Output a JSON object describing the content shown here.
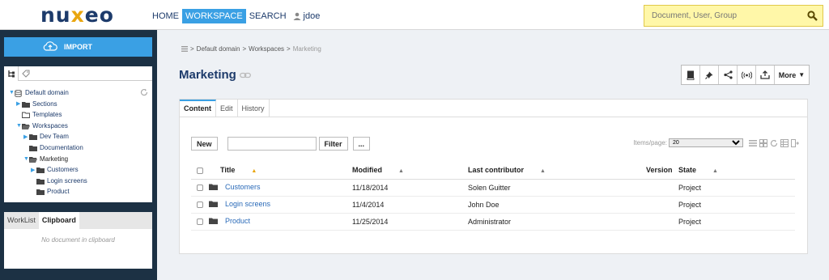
{
  "header": {
    "logo_text_1": "nu",
    "logo_text_2": "x",
    "logo_text_3": "eo",
    "nav": [
      "HOME",
      "WORKSPACE",
      "SEARCH"
    ],
    "active_nav": "WORKSPACE",
    "user": "jdoe",
    "search_placeholder": "Document, User, Group"
  },
  "sidebar": {
    "import_label": "IMPORT",
    "tree": [
      {
        "label": "Default domain",
        "level": 0,
        "expanded": true
      },
      {
        "label": "Sections",
        "level": 1,
        "expanded": false
      },
      {
        "label": "Templates",
        "level": 1,
        "expanded": null
      },
      {
        "label": "Workspaces",
        "level": 1,
        "expanded": true
      },
      {
        "label": "Dev Team",
        "level": 2,
        "expanded": false
      },
      {
        "label": "Documentation",
        "level": 2,
        "expanded": null
      },
      {
        "label": "Marketing",
        "level": 2,
        "expanded": true,
        "selected": true
      },
      {
        "label": "Customers",
        "level": 3,
        "expanded": false
      },
      {
        "label": "Login screens",
        "level": 3,
        "expanded": null
      },
      {
        "label": "Product",
        "level": 3,
        "expanded": null
      }
    ],
    "clip_tabs": [
      "WorkList",
      "Clipboard"
    ],
    "active_clip_tab": "Clipboard",
    "clip_empty": "No document in clipboard"
  },
  "main": {
    "breadcrumb": [
      "Default domain",
      "Workspaces",
      "Marketing"
    ],
    "title": "Marketing",
    "more_label": "More",
    "tabs": [
      "Content",
      "Edit",
      "History"
    ],
    "active_tab": "Content",
    "new_label": "New",
    "filter_label": "Filter",
    "dots_label": "...",
    "items_per_page_label": "Items/page",
    "items_per_page_value": "20",
    "columns": [
      "Title",
      "Modified",
      "Last contributor",
      "Version",
      "State"
    ],
    "rows": [
      {
        "title": "Customers",
        "modified": "11/18/2014",
        "contributor": "Solen Guitter",
        "version": "",
        "state": "Project"
      },
      {
        "title": "Login screens",
        "modified": "11/4/2014",
        "contributor": "John Doe",
        "version": "",
        "state": "Project"
      },
      {
        "title": "Product",
        "modified": "11/25/2014",
        "contributor": "Administrator",
        "version": "",
        "state": "Project"
      }
    ]
  },
  "colors": {
    "accent": "#3aa0e4",
    "brand": "#1d3b6b",
    "sidebar_bg": "#1c3144",
    "search_bg": "#fff7a8"
  }
}
